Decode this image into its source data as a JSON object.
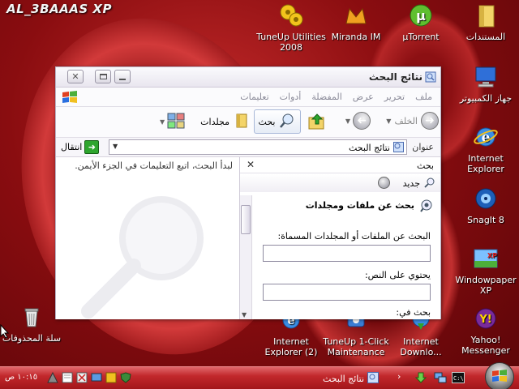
{
  "desktop": {
    "brand": "AL_3BAAAS XP",
    "icons": {
      "tuneup": "TuneUp Utilities 2008",
      "miranda": "Miranda IM",
      "utorrent": "µTorrent",
      "documents": "المستندات",
      "computer": "جهاز الكمبيوتر",
      "ie": "Internet Explorer",
      "snagit": "SnagIt 8",
      "wallpaper": "Windowpaper XP",
      "yahoo": "Yahoo! Messenger",
      "ie_download": "Internet Downlo...",
      "tuneup_1click": "TuneUp 1-Click Maintenance",
      "ie2": "Internet Explorer (2)",
      "recycle": "سلة المحذوفات"
    }
  },
  "window": {
    "title": "نتائج البحث",
    "menu": [
      "ملف",
      "تحرير",
      "عرض",
      "المفضلة",
      "أدوات",
      "تعليمات"
    ],
    "toolbar": {
      "back": "الخلف",
      "search": "بحث",
      "folders": "مجلدات"
    },
    "address": {
      "label": "عنوان",
      "value": "نتائج البحث",
      "go": "انتقال"
    },
    "search_pane": {
      "header": "بحث",
      "new": "جديد",
      "section_title": "بحث عن ملفات ومجلدات",
      "name_label": "البحث عن الملفات أو المجلدات المسماة:",
      "name_value": "",
      "text_label": "يحتوي على النص:",
      "text_value": "",
      "look_in_label": "بحث في:"
    },
    "results_message": "لبدأ البحث، اتبع التعليمات في الجزء الأيمن."
  },
  "taskbar": {
    "task_label": "نتائج البحث",
    "clock": "١٠:١٥ ص"
  }
}
